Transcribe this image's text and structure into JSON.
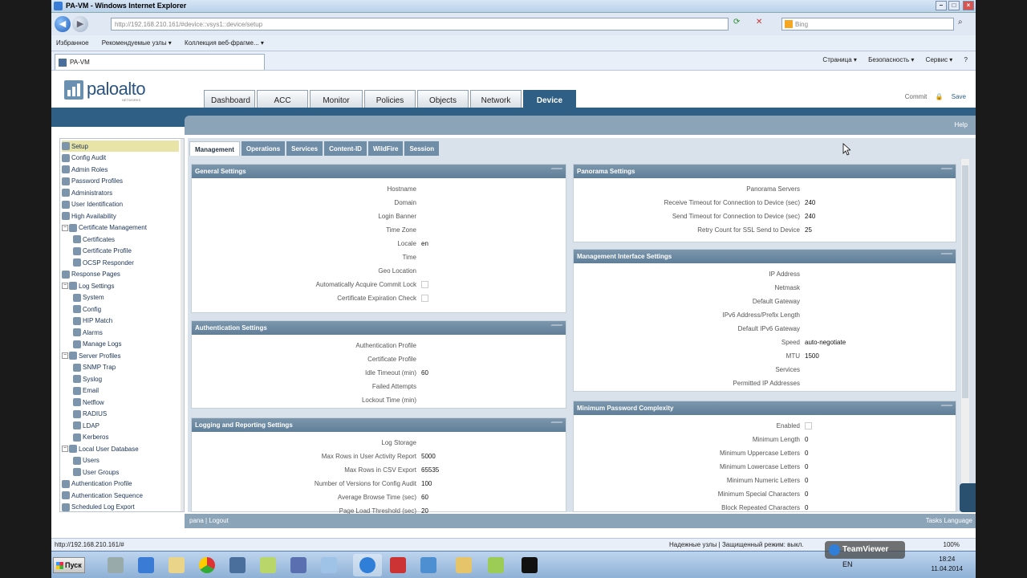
{
  "browser": {
    "title": "PA-VM - Windows Internet Explorer",
    "url": "http://192.168.210.161/#device::vsys1::device/setup",
    "url_host": "http://192.168.210.161",
    "search_placeholder": "Bing",
    "favorites_label": "Избранное",
    "fav_links": [
      "Рекомендуемые узлы ▾",
      "Коллекция веб-фрагме... ▾"
    ],
    "tab_title": "PA-VM",
    "menu": [
      "Страница ▾",
      "Безопасность ▾",
      "Сервис ▾"
    ],
    "status_url": "http://192.168.210.161/#",
    "zone": "Надежные узлы | Защищенный режим: выкл.",
    "zoom": "100%"
  },
  "app": {
    "logo": "paloalto",
    "logo_sub": "NETWORKS",
    "main_tabs": [
      "Dashboard",
      "ACC",
      "Monitor",
      "Policies",
      "Objects",
      "Network",
      "Device"
    ],
    "active_tab": "Device",
    "commit_label": "Commit",
    "save_label": "Save",
    "help_label": "Help",
    "footer_user": "pana",
    "footer_logout": "Logout",
    "footer_tasks": "Tasks",
    "footer_language": "Language"
  },
  "nav_tree": [
    {
      "label": "Setup",
      "level": 0,
      "selected": true
    },
    {
      "label": "Config Audit",
      "level": 0
    },
    {
      "label": "Admin Roles",
      "level": 0
    },
    {
      "label": "Password Profiles",
      "level": 0
    },
    {
      "label": "Administrators",
      "level": 0
    },
    {
      "label": "User Identification",
      "level": 0
    },
    {
      "label": "High Availability",
      "level": 0
    },
    {
      "label": "Certificate Management",
      "level": 0,
      "toggle": "⊟"
    },
    {
      "label": "Certificates",
      "level": 1
    },
    {
      "label": "Certificate Profile",
      "level": 1
    },
    {
      "label": "OCSP Responder",
      "level": 1
    },
    {
      "label": "Response Pages",
      "level": 0
    },
    {
      "label": "Log Settings",
      "level": 0,
      "toggle": "⊟"
    },
    {
      "label": "System",
      "level": 1
    },
    {
      "label": "Config",
      "level": 1
    },
    {
      "label": "HIP Match",
      "level": 1
    },
    {
      "label": "Alarms",
      "level": 1
    },
    {
      "label": "Manage Logs",
      "level": 1
    },
    {
      "label": "Server Profiles",
      "level": 0,
      "toggle": "⊟"
    },
    {
      "label": "SNMP Trap",
      "level": 1
    },
    {
      "label": "Syslog",
      "level": 1
    },
    {
      "label": "Email",
      "level": 1
    },
    {
      "label": "Netflow",
      "level": 1
    },
    {
      "label": "RADIUS",
      "level": 1
    },
    {
      "label": "LDAP",
      "level": 1
    },
    {
      "label": "Kerberos",
      "level": 1
    },
    {
      "label": "Local User Database",
      "level": 0,
      "toggle": "⊟"
    },
    {
      "label": "Users",
      "level": 1
    },
    {
      "label": "User Groups",
      "level": 1
    },
    {
      "label": "Authentication Profile",
      "level": 0
    },
    {
      "label": "Authentication Sequence",
      "level": 0
    },
    {
      "label": "Scheduled Log Export",
      "level": 0
    }
  ],
  "sub_tabs": [
    "Management",
    "Operations",
    "Services",
    "Content-ID",
    "WildFire",
    "Session"
  ],
  "active_sub_tab": "Management",
  "general_settings": {
    "title": "General Settings",
    "rows": [
      {
        "label": "Hostname",
        "value": ""
      },
      {
        "label": "Domain",
        "value": ""
      },
      {
        "label": "Login Banner",
        "value": ""
      },
      {
        "label": "Time Zone",
        "value": ""
      },
      {
        "label": "Locale",
        "value": "en"
      },
      {
        "label": "Time",
        "value": ""
      },
      {
        "label": "Geo Location",
        "value": ""
      },
      {
        "label": "Automatically Acquire Commit Lock",
        "value": "",
        "checkbox": true
      },
      {
        "label": "Certificate Expiration Check",
        "value": "",
        "checkbox": true
      }
    ]
  },
  "authentication_settings": {
    "title": "Authentication Settings",
    "rows": [
      {
        "label": "Authentication Profile",
        "value": ""
      },
      {
        "label": "Certificate Profile",
        "value": ""
      },
      {
        "label": "Idle Timeout (min)",
        "value": "60"
      },
      {
        "label": "Failed Attempts",
        "value": ""
      },
      {
        "label": "Lockout Time (min)",
        "value": ""
      }
    ]
  },
  "logging_settings": {
    "title": "Logging and Reporting Settings",
    "rows": [
      {
        "label": "Log Storage",
        "value": ""
      },
      {
        "label": "Max Rows in User Activity Report",
        "value": "5000"
      },
      {
        "label": "Max Rows in CSV Export",
        "value": "65535"
      },
      {
        "label": "Number of Versions for Config Audit",
        "value": "100"
      },
      {
        "label": "Average Browse Time (sec)",
        "value": "60"
      },
      {
        "label": "Page Load Threshold (sec)",
        "value": "20"
      }
    ]
  },
  "panorama_settings": {
    "title": "Panorama Settings",
    "rows": [
      {
        "label": "Panorama Servers",
        "value": ""
      },
      {
        "label": "Receive Timeout for Connection to Device (sec)",
        "value": "240"
      },
      {
        "label": "Send Timeout for Connection to Device (sec)",
        "value": "240"
      },
      {
        "label": "Retry Count for SSL Send to Device",
        "value": "25"
      }
    ]
  },
  "mgmt_interface_settings": {
    "title": "Management Interface Settings",
    "rows": [
      {
        "label": "IP Address",
        "value": ""
      },
      {
        "label": "Netmask",
        "value": ""
      },
      {
        "label": "Default Gateway",
        "value": ""
      },
      {
        "label": "IPv6 Address/Prefix Length",
        "value": ""
      },
      {
        "label": "Default IPv6 Gateway",
        "value": ""
      },
      {
        "label": "Speed",
        "value": "auto-negotiate"
      },
      {
        "label": "MTU",
        "value": "1500"
      },
      {
        "label": "Services",
        "value": ""
      },
      {
        "label": "Permitted IP Addresses",
        "value": ""
      }
    ]
  },
  "password_complexity": {
    "title": "Minimum Password Complexity",
    "rows": [
      {
        "label": "Enabled",
        "value": "",
        "checkbox": true
      },
      {
        "label": "Minimum Length",
        "value": "0"
      },
      {
        "label": "Minimum Uppercase Letters",
        "value": "0"
      },
      {
        "label": "Minimum Lowercase Letters",
        "value": "0"
      },
      {
        "label": "Minimum Numeric Letters",
        "value": "0"
      },
      {
        "label": "Minimum Special Characters",
        "value": "0"
      },
      {
        "label": "Block Repeated Characters",
        "value": "0"
      }
    ]
  },
  "taskbar": {
    "start_label": "Пуск",
    "language": "EN",
    "time": "18:24",
    "date": "11.04.2014",
    "teamviewer": "TeamViewer"
  },
  "colors": {
    "brand": "#2f5f85",
    "panel_header": "#6f8da6",
    "content_bg": "#d9e2ea"
  }
}
